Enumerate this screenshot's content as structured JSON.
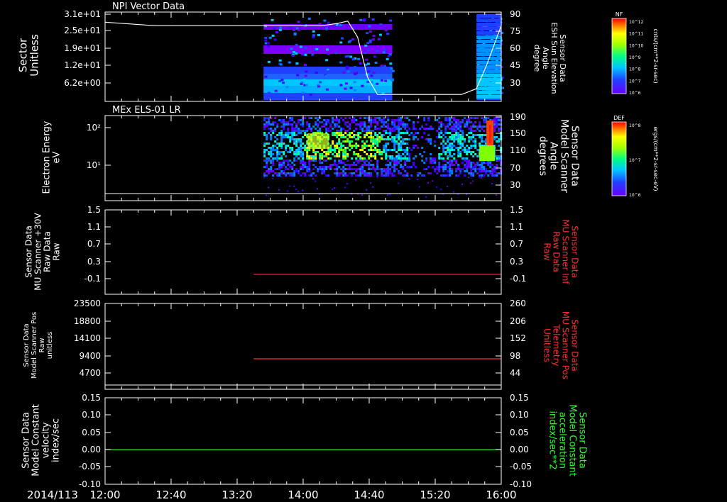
{
  "chart_data": [
    {
      "type": "heatmap",
      "title": "NPI Vector Data",
      "ylabel": [
        "Sector",
        "Unitless"
      ],
      "yticks": [
        "3.1e+01",
        "2.5e+01",
        "1.9e+01",
        "1.2e+01",
        "6.2e+00"
      ],
      "y2label": [
        "Sensor Data",
        "ESH Sun Elevation",
        "Angle",
        "degree"
      ],
      "y2ticks": [
        "90",
        "75",
        "60",
        "45",
        "30"
      ],
      "ylim2": [
        15,
        90
      ],
      "colorbar": {
        "label": "NF",
        "ticks": [
          "10^12",
          "10^11",
          "10^10",
          "10^9",
          "10^8",
          "10^7",
          "10^6"
        ],
        "units": "cnts/(cm**2-sr-sec)"
      },
      "data_extent_hours": [
        [
          13.6,
          14.9
        ],
        [
          15.75,
          16.0
        ]
      ],
      "line": {
        "name": "ESH Sun Elevation Angle",
        "x": [
          12.0,
          12.5,
          13.0,
          13.6,
          14.2,
          14.35,
          14.45,
          14.55,
          14.65,
          14.75,
          15.2,
          15.6,
          15.75,
          15.85,
          16.0
        ],
        "y": [
          83,
          80,
          80,
          80,
          80,
          82,
          84,
          70,
          35,
          20,
          20,
          20,
          25,
          45,
          80
        ]
      }
    },
    {
      "type": "heatmap",
      "title": "MEx ELS-01 LR",
      "ylabel": [
        "Electron Energy",
        "eV"
      ],
      "yticks": [
        "10²",
        "10¹"
      ],
      "y2label": [
        "Sensor Data",
        "Model Scanner",
        "Angle",
        "degrees"
      ],
      "y2ticks": [
        "190",
        "150",
        "110",
        "70",
        "30"
      ],
      "colorbar": {
        "label": "DEF",
        "ticks": [
          "10^8",
          "10^7",
          "10^6"
        ],
        "units": "ergs/(cm**2-sr-sec-eV)"
      },
      "line": {
        "name": "Model Scanner Angle",
        "x": [
          12.0,
          16.0
        ],
        "y": [
          15,
          15
        ]
      },
      "hotspots": [
        {
          "x": [
            14.0,
            14.8
          ],
          "energy_ev": 20,
          "level": "yellow-green"
        },
        {
          "x": [
            15.75,
            15.95
          ],
          "energy_ev": 100,
          "level": "red"
        }
      ]
    },
    {
      "type": "line",
      "ylabel": [
        "Sensor Data",
        "MU Scanner +30V",
        "Raw Data",
        "Raw"
      ],
      "yticks": [
        "1.5",
        "1.1",
        "0.7",
        "0.3",
        "-0.1"
      ],
      "ylim": [
        -0.3,
        1.5
      ],
      "y2label": [
        "Sensor Data",
        "MU Scanner Inf",
        "Raw Data",
        "Raw"
      ],
      "y2ticks": [
        "1.5",
        "1.1",
        "0.7",
        "0.3",
        "-0.1"
      ],
      "series": [
        {
          "color": "#ff3030",
          "x": [
            13.5,
            16.0
          ],
          "y": [
            0.0,
            0.0
          ]
        }
      ]
    },
    {
      "type": "line",
      "ylabel": [
        "Sensor Data",
        "Model Scanner Pos",
        "Raw",
        "unitless"
      ],
      "yticks": [
        "23500",
        "18800",
        "14100",
        "9400",
        "4700"
      ],
      "ylim": [
        0,
        23500
      ],
      "y2label": [
        "Sensor Data",
        "MU Scanner Pos",
        "Telemetry",
        "Unitless"
      ],
      "y2ticks": [
        "260",
        "206",
        "152",
        "98",
        "44"
      ],
      "ylim2": [
        0,
        260
      ],
      "series": [
        {
          "color": "#ff3030",
          "x": [
            13.5,
            16.0
          ],
          "y2": [
            88,
            88
          ]
        }
      ]
    },
    {
      "type": "line",
      "ylabel": [
        "Sensor Data",
        "Model Constant",
        "velocity",
        "index/sec"
      ],
      "yticks": [
        "0.15",
        "0.10",
        "0.05",
        "0.00",
        "-0.05",
        "-0.10"
      ],
      "ylim": [
        -0.1,
        0.15
      ],
      "y2label": [
        "Sensor Data",
        "Model Constant",
        "acceleration",
        "index/sec**2"
      ],
      "y2ticks": [
        "0.15",
        "0.10",
        "0.05",
        "0.00",
        "-0.05",
        "-0.10"
      ],
      "series": [
        {
          "color": "#30ff30",
          "x": [
            12.0,
            16.0
          ],
          "y": [
            0.0,
            0.0
          ]
        }
      ]
    }
  ],
  "x_axis": {
    "date": "2014/113",
    "ticks": [
      "12:00",
      "12:40",
      "13:20",
      "14:00",
      "14:40",
      "15:20",
      "16:00"
    ],
    "range_hours": [
      12.0,
      16.0
    ]
  },
  "colors": {
    "background": "#000000",
    "axes": "#ffffff",
    "red_label": "#ff3030",
    "green_label": "#30ff30"
  }
}
